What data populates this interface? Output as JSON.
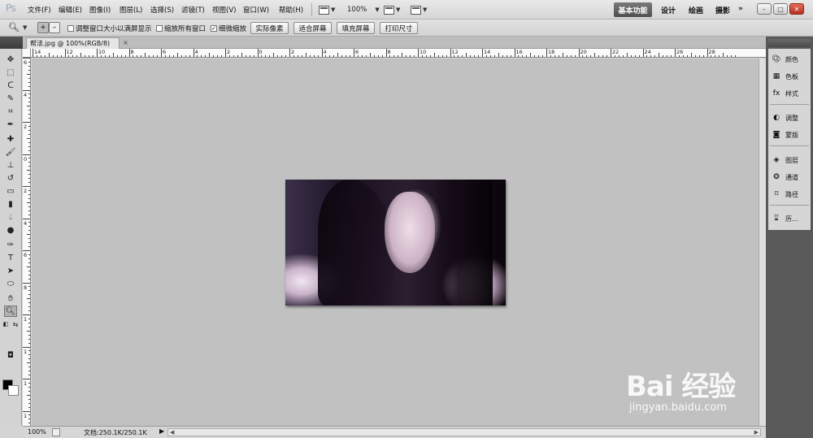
{
  "app": {
    "logo": "Ps"
  },
  "menu": [
    "文件(F)",
    "编辑(E)",
    "图像(I)",
    "图层(L)",
    "选择(S)",
    "滤镜(T)",
    "视图(V)",
    "窗口(W)",
    "帮助(H)"
  ],
  "menubar_controls": {
    "zoom_level": "100%"
  },
  "workspaces": {
    "active": "基本功能",
    "items": [
      "设计",
      "绘画",
      "摄影"
    ],
    "more": "»"
  },
  "window_buttons": {
    "minimize": "–",
    "restore": "□",
    "close": "✕"
  },
  "options": {
    "resize_windows": "调整窗口大小以满屏显示",
    "zoom_all_windows": "缩放所有窗口",
    "scrubby_zoom": "细微缩放",
    "actual_pixels": "实际像素",
    "fit_screen": "适合屏幕",
    "fill_screen": "填充屏幕",
    "print_size": "打印尺寸"
  },
  "document": {
    "tab_title": "帮法.jpg @ 100%(RGB/8)",
    "close": "×"
  },
  "ruler_h_labels": [
    "14",
    "12",
    "10",
    "8",
    "6",
    "4",
    "2",
    "0",
    "2",
    "4",
    "6",
    "8",
    "10",
    "12",
    "14",
    "16",
    "18",
    "20",
    "22",
    "24",
    "26",
    "28"
  ],
  "ruler_v_labels": [
    "6",
    "4",
    "2",
    "0",
    "2",
    "4",
    "6",
    "8",
    "1",
    "1",
    "1",
    "1"
  ],
  "status": {
    "zoom": "100%",
    "doc_info": "文档:250.1K/250.1K"
  },
  "right_panel": {
    "group1": [
      {
        "label": "颜色",
        "icon": "color-icon"
      },
      {
        "label": "色板",
        "icon": "swatches-icon"
      },
      {
        "label": "样式",
        "icon": "styles-icon"
      }
    ],
    "group2": [
      {
        "label": "调整",
        "icon": "adjustments-icon"
      },
      {
        "label": "蒙版",
        "icon": "masks-icon"
      }
    ],
    "group3": [
      {
        "label": "图层",
        "icon": "layers-icon"
      },
      {
        "label": "通道",
        "icon": "channels-icon"
      },
      {
        "label": "路径",
        "icon": "paths-icon"
      }
    ],
    "group4": [
      {
        "label": "历...",
        "icon": "history-icon"
      }
    ]
  },
  "watermark": {
    "logo": "Bai 经验",
    "url": "jingyan.baidu.com"
  },
  "colors": {
    "menubar": "#dcdcdc",
    "canvas_bg": "#c1c1c1",
    "dock": "#595959",
    "active_workspace": "#5a5a5a"
  }
}
